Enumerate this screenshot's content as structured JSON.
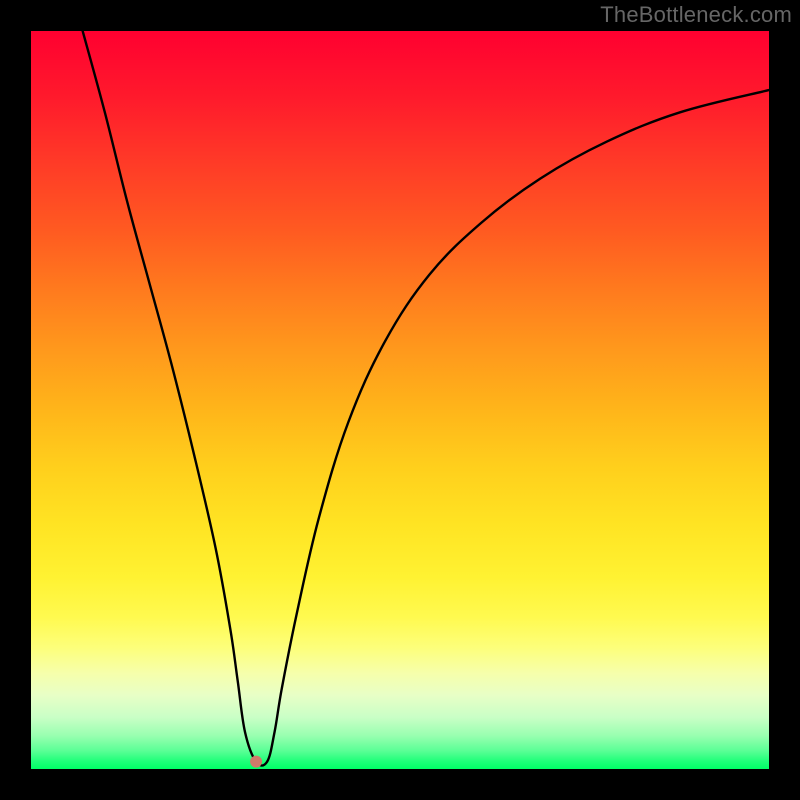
{
  "watermark": "TheBottleneck.com",
  "chart_data": {
    "type": "line",
    "title": "",
    "xlabel": "",
    "ylabel": "",
    "xlim": [
      0,
      100
    ],
    "ylim": [
      0,
      100
    ],
    "grid": false,
    "legend": false,
    "series": [
      {
        "name": "bottleneck-curve",
        "x": [
          7,
          10,
          13,
          16,
          19,
          22,
          25,
          27,
          28,
          29,
          30.5,
          32,
          33,
          34,
          36,
          39,
          43,
          48,
          54,
          61,
          69,
          78,
          88,
          100
        ],
        "values": [
          100,
          89,
          77,
          66,
          55,
          43,
          30,
          19,
          12,
          5,
          1,
          1,
          5,
          11,
          21,
          34,
          47,
          58,
          67,
          74,
          80,
          85,
          89,
          92
        ]
      }
    ],
    "marker": {
      "x": 30.5,
      "y": 1,
      "color": "#d07a6a",
      "radius_px": 6
    },
    "background_gradient": {
      "orientation": "vertical",
      "stops": [
        {
          "pos": 0.0,
          "color": "#ff0030"
        },
        {
          "pos": 0.09,
          "color": "#ff1a2c"
        },
        {
          "pos": 0.18,
          "color": "#ff3b27"
        },
        {
          "pos": 0.27,
          "color": "#ff5a21"
        },
        {
          "pos": 0.35,
          "color": "#ff7a1e"
        },
        {
          "pos": 0.43,
          "color": "#ff981c"
        },
        {
          "pos": 0.51,
          "color": "#ffb41a"
        },
        {
          "pos": 0.59,
          "color": "#ffcf1c"
        },
        {
          "pos": 0.67,
          "color": "#ffe423"
        },
        {
          "pos": 0.74,
          "color": "#fff232"
        },
        {
          "pos": 0.795,
          "color": "#fffa50"
        },
        {
          "pos": 0.835,
          "color": "#fdff7a"
        },
        {
          "pos": 0.87,
          "color": "#f6ffab"
        },
        {
          "pos": 0.9,
          "color": "#e8ffc6"
        },
        {
          "pos": 0.93,
          "color": "#c9ffc6"
        },
        {
          "pos": 0.955,
          "color": "#98ffb0"
        },
        {
          "pos": 0.975,
          "color": "#5cff96"
        },
        {
          "pos": 0.99,
          "color": "#1dff78"
        },
        {
          "pos": 1.0,
          "color": "#00ff66"
        }
      ]
    },
    "frame": {
      "color": "#000000",
      "inner_size_px": 738,
      "outer_size_px": 800
    }
  }
}
